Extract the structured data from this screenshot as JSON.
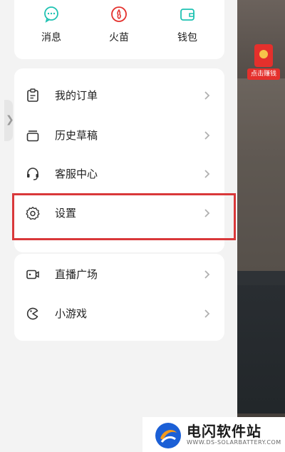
{
  "quick_actions": [
    {
      "label": "消息",
      "icon": "message-icon"
    },
    {
      "label": "火苗",
      "icon": "flame-icon"
    },
    {
      "label": "钱包",
      "icon": "wallet-icon"
    }
  ],
  "menu": [
    {
      "label": "我的订单",
      "icon": "order-icon"
    },
    {
      "label": "历史草稿",
      "icon": "drafts-icon"
    },
    {
      "label": "客服中心",
      "icon": "headset-icon"
    },
    {
      "label": "设置",
      "icon": "gear-icon"
    },
    {
      "label": "直播广场",
      "icon": "live-icon"
    },
    {
      "label": "小游戏",
      "icon": "game-icon"
    }
  ],
  "red_packet": {
    "label": "点击赚钱",
    "icon": "red-packet-icon"
  },
  "watermark": {
    "name": "电闪软件站",
    "url": "WWW.DS-SOLARBATTERY.COM"
  },
  "colors": {
    "accent_teal": "#1fc2b2",
    "accent_red": "#e4302c",
    "highlight": "#d9383a"
  }
}
